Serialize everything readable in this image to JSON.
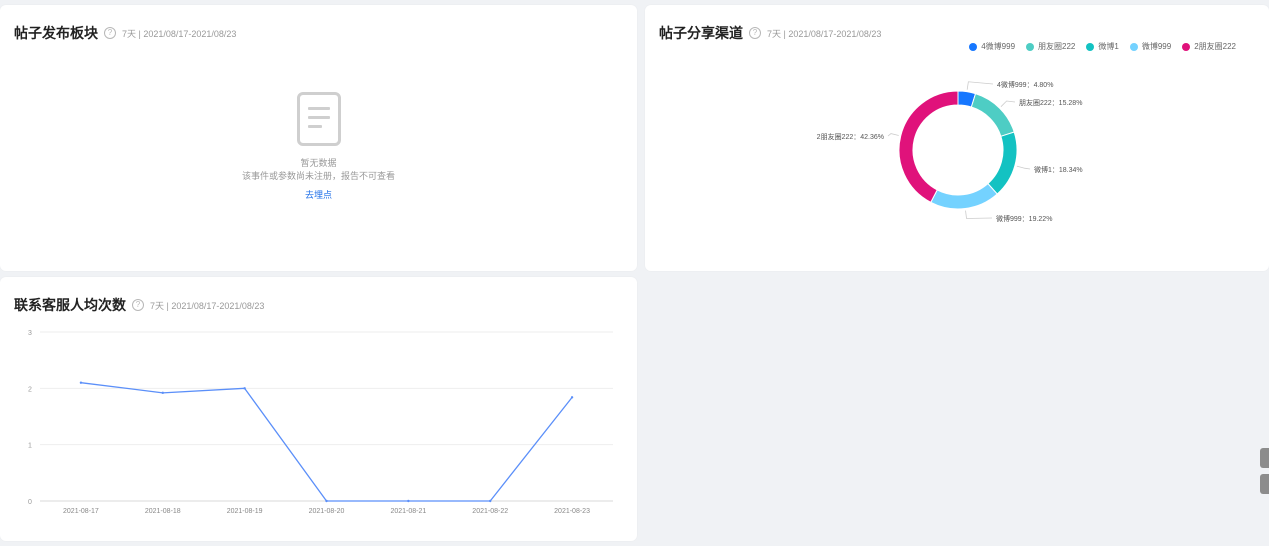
{
  "card_post_board": {
    "title": "帖子发布板块",
    "help": "?",
    "meta": "7天 | 2021/08/17-2021/08/23",
    "empty": {
      "title": "暂无数据",
      "desc": "该事件或参数尚未注册，报告不可查看",
      "link": "去埋点"
    }
  },
  "card_share_channel": {
    "title": "帖子分享渠道",
    "help": "?",
    "meta": "7天 | 2021/08/17-2021/08/23"
  },
  "card_contact_service": {
    "title": "联系客服人均次数",
    "help": "?",
    "meta": "7天 | 2021/08/17-2021/08/23"
  },
  "chart_data": [
    {
      "type": "pie",
      "variant": "donut",
      "legend_position": "top-right",
      "slices": [
        {
          "name": "4微博999",
          "value": 4.8,
          "label": "4微博999：4.80%",
          "color": "#1677ff"
        },
        {
          "name": "朋友圈222",
          "value": 15.28,
          "label": "朋友圈222：15.28%",
          "color": "#4ecdc4"
        },
        {
          "name": "微博1",
          "value": 18.34,
          "label": "微博1：18.34%",
          "color": "#13c2c2"
        },
        {
          "name": "微博999",
          "value": 19.22,
          "label": "微博999：19.22%",
          "color": "#74d2ff"
        },
        {
          "name": "2朋友圈222",
          "value": 42.36,
          "label": "2朋友圈222：42.36%",
          "color": "#e0127b"
        }
      ]
    },
    {
      "type": "line",
      "x": [
        "2021-08-17",
        "2021-08-18",
        "2021-08-19",
        "2021-08-20",
        "2021-08-21",
        "2021-08-22",
        "2021-08-23"
      ],
      "series": [
        {
          "values": [
            2.1,
            1.92,
            2.0,
            0,
            0,
            0,
            1.84
          ],
          "color": "#5b8ff9"
        }
      ],
      "ylim": [
        0,
        3
      ],
      "yticks": [
        "0",
        "1",
        "2",
        "3"
      ],
      "grid": true
    }
  ]
}
